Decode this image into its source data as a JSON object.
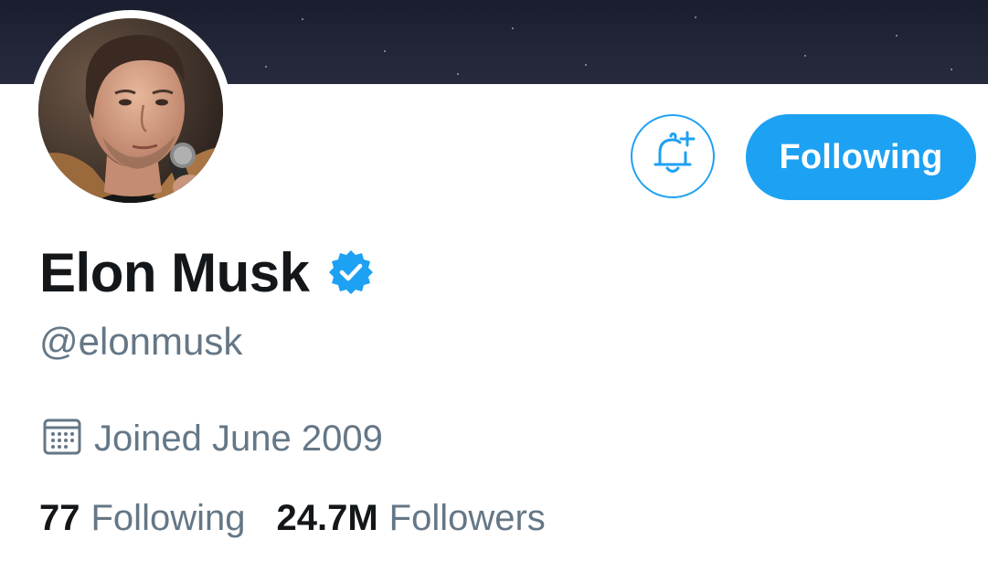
{
  "profile": {
    "display_name": "Elon Musk",
    "handle": "@elonmusk",
    "verified": true,
    "joined": "Joined June 2009"
  },
  "actions": {
    "following_label": "Following",
    "notify_icon": "bell-plus-icon"
  },
  "stats": {
    "following_count": "77",
    "following_label": "Following",
    "followers_count": "24.7M",
    "followers_label": "Followers"
  },
  "colors": {
    "accent": "#1da1f2",
    "text_primary": "#14171a",
    "text_secondary": "#657786",
    "banner": "#1f2334"
  }
}
